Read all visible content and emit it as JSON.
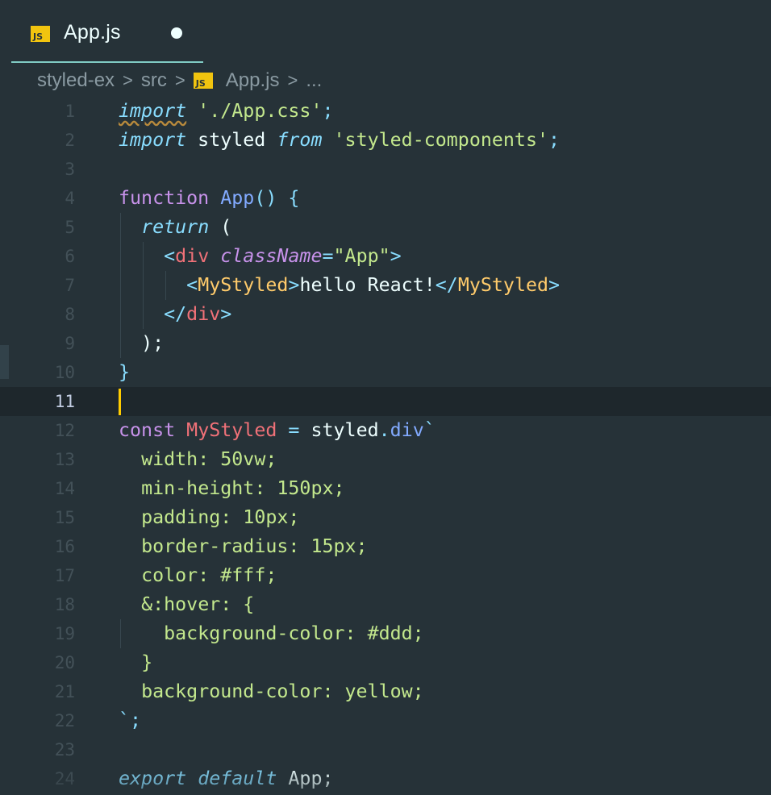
{
  "tab": {
    "label": "App.js",
    "icon": "js-file-icon",
    "icon_text": "JS",
    "dirty": true
  },
  "breadcrumb": {
    "items": [
      "styled-ex",
      "src",
      "App.js",
      "..."
    ],
    "separator": ">",
    "file_icon_text": "JS"
  },
  "editor": {
    "active_line": 11,
    "lines": [
      {
        "n": "1",
        "tokens": [
          [
            "import",
            "kwit warn"
          ],
          [
            " ",
            "p"
          ],
          [
            "'./App.css'",
            "str"
          ],
          [
            ";",
            "punc"
          ]
        ]
      },
      {
        "n": "2",
        "tokens": [
          [
            "import",
            "kwit"
          ],
          [
            " styled ",
            "p"
          ],
          [
            "from",
            "kwit"
          ],
          [
            " ",
            "p"
          ],
          [
            "'styled-components'",
            "str"
          ],
          [
            ";",
            "punc"
          ]
        ]
      },
      {
        "n": "3",
        "tokens": []
      },
      {
        "n": "4",
        "tokens": [
          [
            "function",
            "kw"
          ],
          [
            " ",
            "p"
          ],
          [
            "App",
            "fn"
          ],
          [
            "() {",
            "punc"
          ]
        ]
      },
      {
        "n": "5",
        "indent": 1,
        "tokens": [
          [
            "  ",
            "p"
          ],
          [
            "return",
            "kwit"
          ],
          [
            " (",
            "p"
          ]
        ]
      },
      {
        "n": "6",
        "indent": 2,
        "tokens": [
          [
            "    ",
            "p"
          ],
          [
            "<",
            "punc"
          ],
          [
            "div",
            "tag"
          ],
          [
            " ",
            "p"
          ],
          [
            "className",
            "attr"
          ],
          [
            "=",
            "punc"
          ],
          [
            "\"App\"",
            "str"
          ],
          [
            ">",
            "punc"
          ]
        ]
      },
      {
        "n": "7",
        "indent": 3,
        "tokens": [
          [
            "      ",
            "p"
          ],
          [
            "<",
            "punc"
          ],
          [
            "MyStyled",
            "comp"
          ],
          [
            ">",
            "punc"
          ],
          [
            "hello React!",
            "p"
          ],
          [
            "</",
            "punc"
          ],
          [
            "MyStyled",
            "comp"
          ],
          [
            ">",
            "punc"
          ]
        ]
      },
      {
        "n": "8",
        "indent": 2,
        "tokens": [
          [
            "    ",
            "p"
          ],
          [
            "</",
            "punc"
          ],
          [
            "div",
            "tag"
          ],
          [
            ">",
            "punc"
          ]
        ]
      },
      {
        "n": "9",
        "indent": 1,
        "tokens": [
          [
            "  ",
            "p"
          ],
          [
            ");",
            "p"
          ]
        ]
      },
      {
        "n": "10",
        "tokens": [
          [
            "}",
            "punc"
          ]
        ]
      },
      {
        "n": "11",
        "tokens": []
      },
      {
        "n": "12",
        "tokens": [
          [
            "const",
            "kw"
          ],
          [
            " ",
            "p"
          ],
          [
            "MyStyled",
            "var"
          ],
          [
            " ",
            "p"
          ],
          [
            "=",
            "punc"
          ],
          [
            " styled",
            "p"
          ],
          [
            ".",
            "punc"
          ],
          [
            "div",
            "fn"
          ],
          [
            "`",
            "punc"
          ]
        ]
      },
      {
        "n": "13",
        "tokens": [
          [
            "  ",
            "p"
          ],
          [
            "width: 50vw;",
            "str"
          ]
        ]
      },
      {
        "n": "14",
        "tokens": [
          [
            "  ",
            "p"
          ],
          [
            "min-height: 150px;",
            "str"
          ]
        ]
      },
      {
        "n": "15",
        "tokens": [
          [
            "  ",
            "p"
          ],
          [
            "padding: 10px;",
            "str"
          ]
        ]
      },
      {
        "n": "16",
        "tokens": [
          [
            "  ",
            "p"
          ],
          [
            "border-radius: 15px;",
            "str"
          ]
        ]
      },
      {
        "n": "17",
        "tokens": [
          [
            "  ",
            "p"
          ],
          [
            "color: #fff;",
            "str"
          ]
        ]
      },
      {
        "n": "18",
        "tokens": [
          [
            "  ",
            "p"
          ],
          [
            "&:hover: {",
            "str"
          ]
        ]
      },
      {
        "n": "19",
        "indent": 1,
        "tokens": [
          [
            "    ",
            "p"
          ],
          [
            "background-color: #ddd;",
            "str"
          ]
        ]
      },
      {
        "n": "20",
        "tokens": [
          [
            "  ",
            "p"
          ],
          [
            "}",
            "str"
          ]
        ]
      },
      {
        "n": "21",
        "tokens": [
          [
            "  ",
            "p"
          ],
          [
            "background-color: yellow;",
            "str"
          ]
        ]
      },
      {
        "n": "22",
        "tokens": [
          [
            "`",
            "punc"
          ],
          [
            ";",
            "punc"
          ]
        ]
      },
      {
        "n": "23",
        "tokens": []
      },
      {
        "n": "24",
        "tokens": [
          [
            "export",
            "kwit"
          ],
          [
            " ",
            "p"
          ],
          [
            "default",
            "kwit"
          ],
          [
            " App;",
            "p"
          ]
        ]
      }
    ]
  },
  "colors": {
    "background": "#263238",
    "active_line": "#1e272c",
    "cursor": "#ffcc00",
    "tab_underline": "#80cbc4",
    "js_icon": "#f1c40f"
  }
}
